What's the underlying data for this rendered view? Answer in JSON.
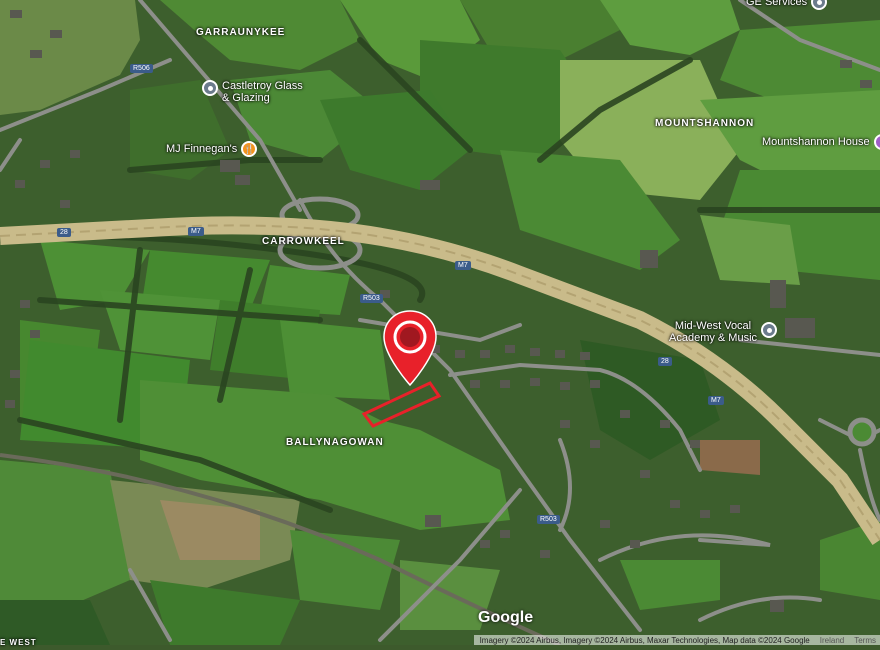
{
  "map": {
    "type": "satellite",
    "colors": {
      "field_light": "#5f9a3c",
      "field_dark": "#3e6e2a",
      "trees": "#2c4a22",
      "road": "#c9bb8a",
      "marker": "#e8212a"
    }
  },
  "places": [
    {
      "name": "GARRAUNYKEE"
    },
    {
      "name": "MOUNTSHANNON"
    },
    {
      "name": "CARROWKEEL"
    },
    {
      "name": "BALLYNAGOWAN"
    },
    {
      "name": "E WEST"
    }
  ],
  "pois": [
    {
      "label": "GE Services",
      "icon": "pin-icon"
    },
    {
      "label": "Castletroy Glass & Glazing",
      "line1": "Castletroy Glass",
      "line2": "& Glazing",
      "icon": "shop-icon"
    },
    {
      "label": "MJ Finnegan's",
      "icon": "restaurant-icon"
    },
    {
      "label": "Mountshannon House",
      "icon": "pin-icon"
    },
    {
      "label": "Mid-West Vocal Academy & Music",
      "line1": "Mid-West Vocal",
      "line2": "Academy & Music",
      "icon": "shop-icon"
    }
  ],
  "road_shields": [
    "R506",
    "M7",
    "M7",
    "R503",
    "M7",
    "R503",
    "28",
    "28"
  ],
  "marker": {
    "icon": "location-pin-icon"
  },
  "branding": {
    "logo": "Google"
  },
  "attribution": {
    "text": "Imagery ©2024 Airbus, Imagery ©2024 Airbus, Maxar Technologies, Map data ©2024 Google",
    "country": "Ireland",
    "terms": "Terms"
  }
}
